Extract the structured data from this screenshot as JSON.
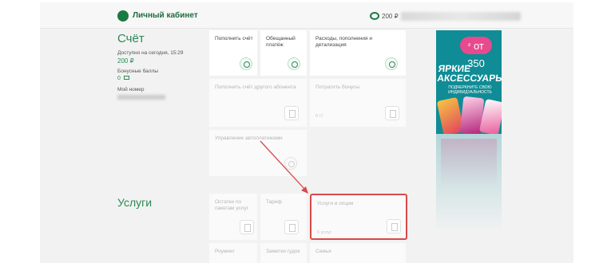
{
  "header": {
    "title": "Личный кабинет",
    "balance": "200 ₽",
    "logo_icon": "lk-logo-icon",
    "balance_icon": "wallet-icon"
  },
  "account": {
    "heading": "Счёт",
    "available_label": "Доступно на сегодня, 15:29",
    "available_value": "200 ₽",
    "bonus_label": "Бонусные баллы",
    "bonus_value": "0",
    "my_number_label": "Мой номер"
  },
  "tiles": {
    "topup": "Пополнить счёт",
    "promised": "Обещанный платёж",
    "expenses": "Расходы, пополнения и детализация",
    "topup_other": "Пополнить счёт другого абонента",
    "spend_bonus": "Потратить бонусы",
    "spend_bonus_note": "0 ☐",
    "autopay": "Управление автоплатежами",
    "remains": "Остатки по пакетам услуг",
    "tariff": "Тариф",
    "services_options": "Услуги и опции",
    "services_note": "6 услуг",
    "roaming": "Роуминг",
    "block": "Заметки гудок",
    "family": "Семья"
  },
  "services": {
    "heading": "Услуги"
  },
  "ad": {
    "price": "от 350",
    "currency": "₽",
    "title": "ЯРКИЕ АКСЕССУАРЫ",
    "subtitle": "ПОДЧЕРКНИТЕ СВОЮ ИНДИВИДУАЛЬНОСТЬ"
  },
  "colors": {
    "brand_green": "#2a8a53",
    "highlight_red": "#d9494a",
    "ad_teal": "#0f8c95",
    "ad_pink": "#e74a8f"
  }
}
